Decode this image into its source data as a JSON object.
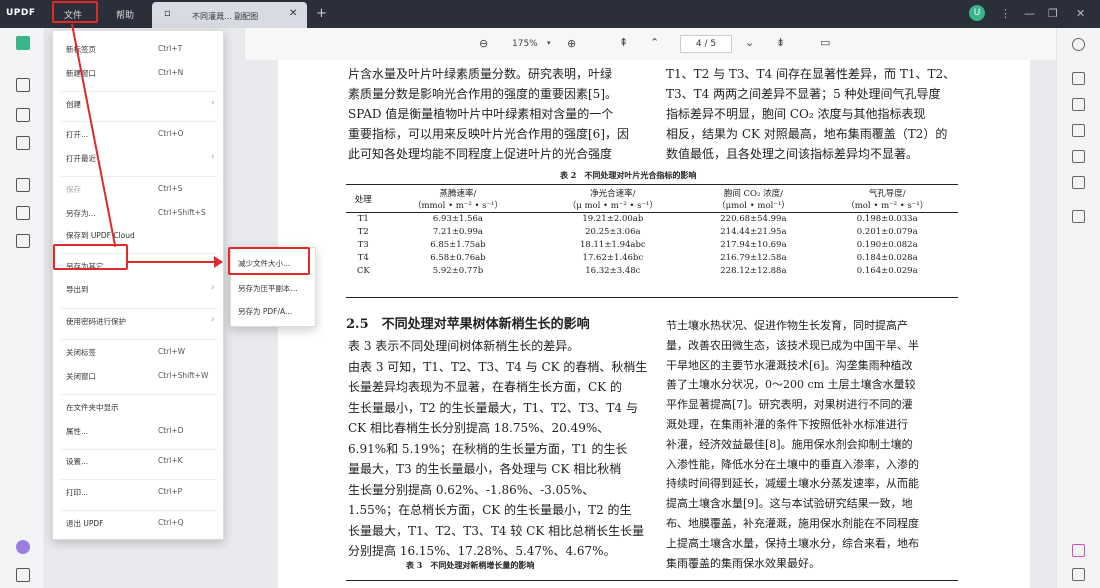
{
  "app": {
    "logo": "UPDF",
    "menu_file": "文件",
    "menu_help": "帮助",
    "tab_title": "不同灌溉... 副配图",
    "tab_plus": "+",
    "avatar": "U"
  },
  "toolbar": {
    "zoom": "175%",
    "page": "4 / 5"
  },
  "file_menu": {
    "items": [
      {
        "label": "新标签页",
        "shortcut": "Ctrl+T"
      },
      {
        "label": "新建窗口",
        "shortcut": "Ctrl+N"
      },
      {
        "label": "创建",
        "shortcut": ""
      },
      {
        "label": "打开...",
        "shortcut": "Ctrl+O"
      },
      {
        "label": "打开最近",
        "shortcut": ""
      },
      {
        "label": "保存",
        "shortcut": "Ctrl+S"
      },
      {
        "label": "另存为...",
        "shortcut": "Ctrl+Shift+S"
      },
      {
        "label": "保存到 UPDF Cloud",
        "shortcut": ""
      },
      {
        "label": "另存为其它",
        "shortcut": ""
      },
      {
        "label": "导出到",
        "shortcut": ""
      },
      {
        "label": "使用密码进行保护",
        "shortcut": ""
      },
      {
        "label": "关闭标签",
        "shortcut": "Ctrl+W"
      },
      {
        "label": "关闭窗口",
        "shortcut": "Ctrl+Shift+W"
      },
      {
        "label": "在文件夹中显示",
        "shortcut": ""
      },
      {
        "label": "属性...",
        "shortcut": "Ctrl+D"
      },
      {
        "label": "设置...",
        "shortcut": "Ctrl+K"
      },
      {
        "label": "打印...",
        "shortcut": "Ctrl+P"
      },
      {
        "label": "退出 UPDF",
        "shortcut": "Ctrl+Q"
      }
    ]
  },
  "submenu": {
    "items": [
      "减少文件大小...",
      "另存为压平副本...",
      "另存为 PDF/A..."
    ]
  },
  "thumb_page": "5",
  "doc": {
    "left_top": [
      "片含水量及叶片叶绿素质量分数。研究表明，叶绿",
      "素质量分数是影响光合作用的强度的重要因素[5]。",
      "SPAD 值是衡量植物叶片中叶绿素相对含量的一个",
      "重要指标，可以用来反映叶片光合作用的强度[6]，因",
      "此可知各处理均能不同程度上促进叶片的光合强度"
    ],
    "right_top": [
      "T1、T2 与 T3、T4 间存在显著性差异，而 T1、T2、",
      "T3、T4 两两之间差异不显著；5 种处理间气孔导度",
      "指标差异不明显，胞间 CO₂ 浓度与其他指标表现",
      "相反，结果为 CK 对照最高，地布集雨覆盖（T2）的",
      "数值最低，且各处理之间该指标差异均不显著。"
    ],
    "table_caption": "表 2　不同处理对叶片光合指标的影响",
    "table_headers": [
      "处理",
      "蒸腾速率/",
      "净光合速率/",
      "胞间 CO₂ 浓度/",
      "气孔导度/"
    ],
    "table_units": [
      "（mmol • m⁻² • s⁻¹）",
      "（μ mol • m⁻² • s⁻¹）",
      "（μmol • mol⁻¹）",
      "（mol • m⁻² • s⁻¹）"
    ],
    "table_rows": [
      [
        "T1",
        "6.93±1.56a",
        "19.21±2.00ab",
        "220.68±54.99a",
        "0.198±0.033a"
      ],
      [
        "T2",
        "7.21±0.99a",
        "20.25±3.06a",
        "214.44±21.95a",
        "0.201±0.079a"
      ],
      [
        "T3",
        "6.85±1.75ab",
        "18.11±1.94abc",
        "217.94±10.69a",
        "0.190±0.082a"
      ],
      [
        "T4",
        "6.58±0.76ab",
        "17.62±1.46bc",
        "216.79±12.58a",
        "0.184±0.028a"
      ],
      [
        "CK",
        "5.92±0.77b",
        "16.32±3.48c",
        "228.12±12.88a",
        "0.164±0.029a"
      ]
    ],
    "section_title": "2.5　不同处理对苹果树体新梢生长的影响",
    "left_body": [
      "表 3 表示不同处理间树体新梢生长的差异。",
      "由表 3 可知，T1、T2、T3、T4 与 CK 的春梢、秋梢生",
      "长量差异均表现为不显著，在春梢生长方面，CK 的",
      "生长量最小，T2 的生长量最大，T1、T2、T3、T4 与",
      "CK 相比春梢生长分别提高 18.75%、20.49%、",
      "6.91%和 5.19%；在秋梢的生长量方面，T1 的生长",
      "量最大，T3 的生长量最小，各处理与 CK 相比秋梢",
      "生长量分别提高 0.62%、-1.86%、-3.05%、",
      "1.55%；在总梢长方面，CK 的生长量最小，T2 的生",
      "长量最大，T1、T2、T3、T4 较 CK 相比总梢长生长量",
      "分别提高 16.15%、17.28%、5.47%、4.67%。"
    ],
    "right_body": [
      "节土壤水热状况、促进作物生长发育，同时提高产",
      "量，改善农田微生态，该技术现已成为中国干旱、半",
      "干旱地区的主要节水灌溉技术[6]。沟垄集雨种植改",
      "善了土壤水分状况，0～200 cm 土层土壤含水量较",
      "平作显著提高[7]。研究表明，对果树进行不同的灌",
      "溉处理，在集雨补灌的条件下按照低补水标准进行",
      "补灌，经济效益最佳[8]。施用保水剂会抑制土壤的",
      "入渗性能，降低水分在土壤中的垂直入渗率，入渗的",
      "持续时间得到延长，减缓土壤水分蒸发速率，从而能",
      "提高土壤含水量[9]。这与本试验研究结果一致，地",
      "布、地膜覆盖，补充灌溉，施用保水剂能在不同程度",
      "上提高土壤含水量，保持土壤水分，综合来看，地布",
      "集雨覆盖的集雨保水效果最好。"
    ],
    "table3_caption": "表 3　不同处理对新梢增长量的影响"
  }
}
